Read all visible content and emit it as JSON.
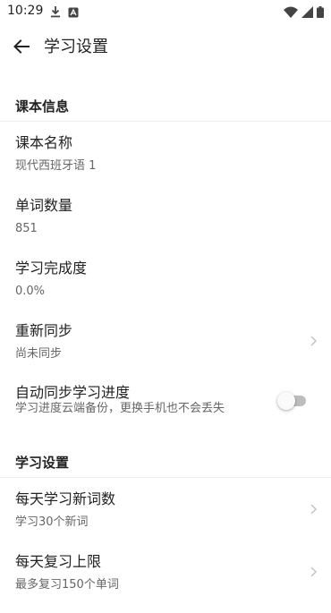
{
  "status_bar": {
    "time": "10:29",
    "left_icons": [
      "download-icon",
      "notification-app-icon"
    ],
    "right_icons": [
      "wifi-icon",
      "cellular-signal-icon",
      "battery-icon"
    ]
  },
  "app_bar": {
    "title": "学习设置",
    "back_icon": "arrow-back-icon"
  },
  "sections": {
    "book_info": {
      "header": "课本信息",
      "book_name": {
        "title": "课本名称",
        "value": "现代西班牙语 1"
      },
      "word_count": {
        "title": "单词数量",
        "value": "851"
      },
      "completion": {
        "title": "学习完成度",
        "value": "0.0%"
      },
      "resync": {
        "title": "重新同步",
        "value": "尚未同步"
      },
      "auto_sync": {
        "title": "自动同步学习进度",
        "description": "学习进度云端备份，更换手机也不会丢失",
        "enabled": false
      }
    },
    "study_settings": {
      "header": "学习设置",
      "daily_new": {
        "title": "每天学习新词数",
        "value": "学习30个新词"
      },
      "daily_review": {
        "title": "每天复习上限",
        "value": "最多复习150个单词"
      }
    }
  },
  "colors": {
    "primary_text": "#222222",
    "secondary_text": "#666666",
    "divider": "#eeeeee",
    "toggle_off_track": "#bdbdbd",
    "toggle_thumb": "#fafafa"
  }
}
